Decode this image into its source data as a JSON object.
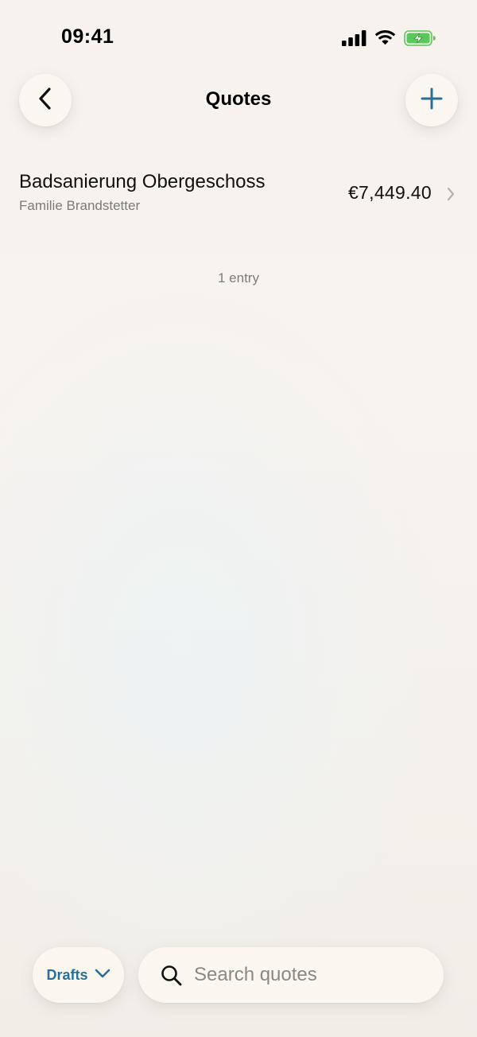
{
  "status_bar": {
    "time": "09:41",
    "icons": [
      "cellular-signal-icon",
      "wifi-icon",
      "battery-charging-icon"
    ],
    "battery_color": "#5ac85a"
  },
  "nav": {
    "title": "Quotes",
    "back_icon": "chevron-left-icon",
    "add_icon": "plus-icon",
    "accent_color": "#2b6f95"
  },
  "quotes": [
    {
      "title": "Badsanierung Obergeschoss",
      "client": "Familie Brandstetter",
      "amount": "€7,449.40"
    }
  ],
  "list": {
    "count_label": "1 entry"
  },
  "bottom_bar": {
    "filter_label": "Drafts",
    "filter_icon": "chevron-down-icon",
    "search_placeholder": "Search quotes",
    "search_icon": "search-icon"
  }
}
